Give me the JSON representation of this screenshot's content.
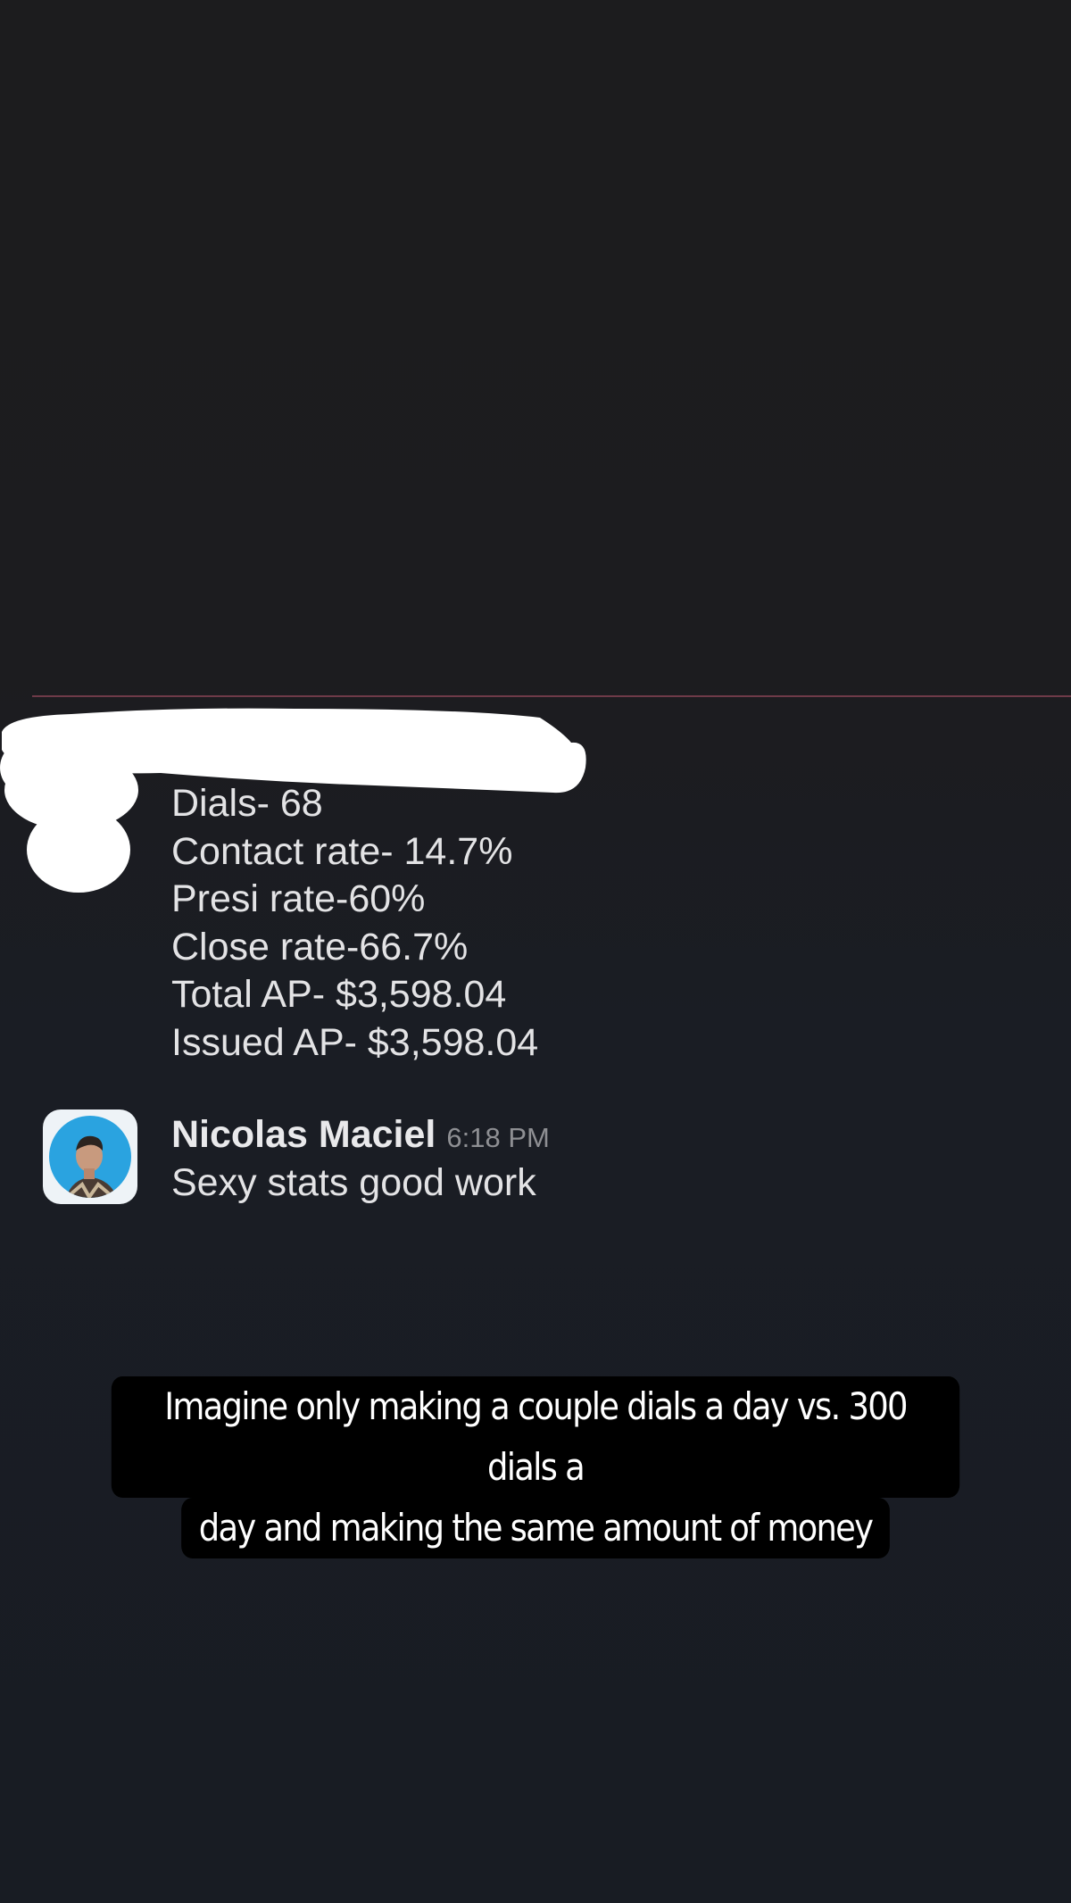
{
  "stats_message": {
    "lines": [
      "Dials- 68",
      "Contact rate- 14.7%",
      "Presi rate-60%",
      "Close rate-66.7%",
      "Total AP- $3,598.04",
      "Issued AP- $3,598.04"
    ]
  },
  "reply": {
    "author": "Nicolas Maciel",
    "time": "6:18 PM",
    "text": "Sexy stats good work",
    "avatar_icon": "profile-photo-avatar"
  },
  "caption": {
    "lines": [
      "Imagine only making a couple dials a day vs. 300 dials a",
      "day and making the same amount of money"
    ]
  },
  "colors": {
    "background": "#1c1c1e",
    "divider": "#6e3a48",
    "caption_background": "#000000",
    "avatar_ring": "#2aa3e0"
  }
}
